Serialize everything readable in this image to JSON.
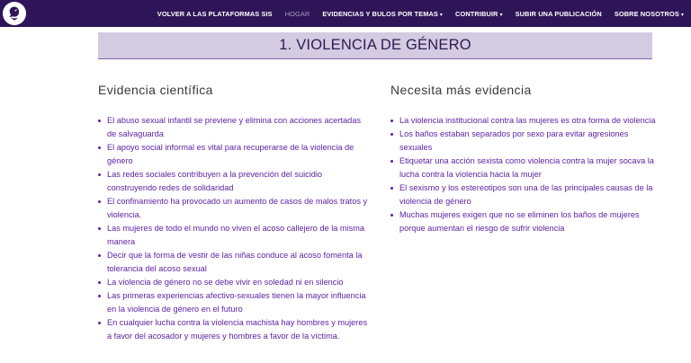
{
  "header": {
    "logo_icon": "woman-profile-icon",
    "nav": [
      {
        "label": "VOLVER A LAS PLATAFORMAS SIS",
        "has_dropdown": false
      },
      {
        "label": "HOGAR",
        "has_dropdown": false,
        "active": true
      },
      {
        "label": "EVIDENCIAS Y BULOS POR TEMAS",
        "has_dropdown": true
      },
      {
        "label": "CONTRIBUIR",
        "has_dropdown": true
      },
      {
        "label": "SUBIR UNA PUBLICACIÓN",
        "has_dropdown": false
      },
      {
        "label": "SOBRE NOSOTROS",
        "has_dropdown": true
      }
    ]
  },
  "page": {
    "title": "1. VIOLENCIA DE GÉNERO"
  },
  "left_column": {
    "heading": "Evidencia científica",
    "items": [
      "El abuso sexual infantil se previene y elimina con acciones acertadas de salvaguarda",
      "El apoyo social informal es vital para recuperarse de la violencia de género",
      "Las redes sociales contribuyen a la prevención del suicidio construyendo redes de solidaridad",
      "El confinamiento ha provocado un aumento de casos de malos tratos y violencia.",
      "Las mujeres de todo el mundo no viven el acoso callejero de la misma manera",
      "Decir que la forma de vestir de las niñas conduce al acoso fomenta la tolerancia del acoso sexual",
      "La violencia de género no se debe vivir en soledad ni en silencio",
      "Las primeras experiencias afectivo-sexuales tienen la mayor influencia en la violencia de género en el futuro",
      "En cualquier lucha contra la violencia machista hay hombres y mujeres a favor del acosador y mujeres y hombres a favor de la víctima."
    ]
  },
  "right_column": {
    "heading": "Necesita más evidencia",
    "items": [
      "La violencia institucional contra las mujeres es otra forma de violencia",
      "Los baños estaban separados por sexo para evitar agresiones sexuales",
      "Etiquetar una acción sexista como violencia contra la mujer socava la lucha contra la violencia hacia la mujer",
      "El sexismo y los estereotipos son una de las principales causas de la violencia de género",
      "Muchas mujeres exigen que no se eliminen los baños de mujeres porque aumentan el riesgo de sufrir violencia"
    ]
  },
  "colors": {
    "topbar": "#2e1557",
    "title_band": "#d3cbe2",
    "link": "#5a1fa0"
  }
}
